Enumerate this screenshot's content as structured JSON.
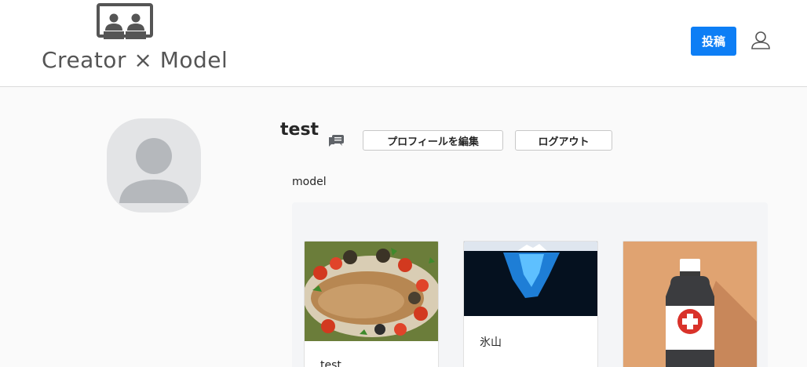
{
  "header": {
    "logo_text": "Creator × Model",
    "post_button_label": "投稿"
  },
  "profile": {
    "username": "test",
    "edit_profile_label": "プロフィールを編集",
    "logout_label": "ログアウト",
    "role": "model"
  },
  "posts": [
    {
      "caption": "test",
      "thumbnail": "seafood-dish-photo"
    },
    {
      "caption": "氷山",
      "thumbnail": "iceberg-photo"
    },
    {
      "caption": "",
      "thumbnail": "medicine-bottle-illustration"
    }
  ],
  "colors": {
    "primary": "#0d7ef5",
    "page_background": "#fafafa",
    "card3_background": "#e0a371"
  }
}
